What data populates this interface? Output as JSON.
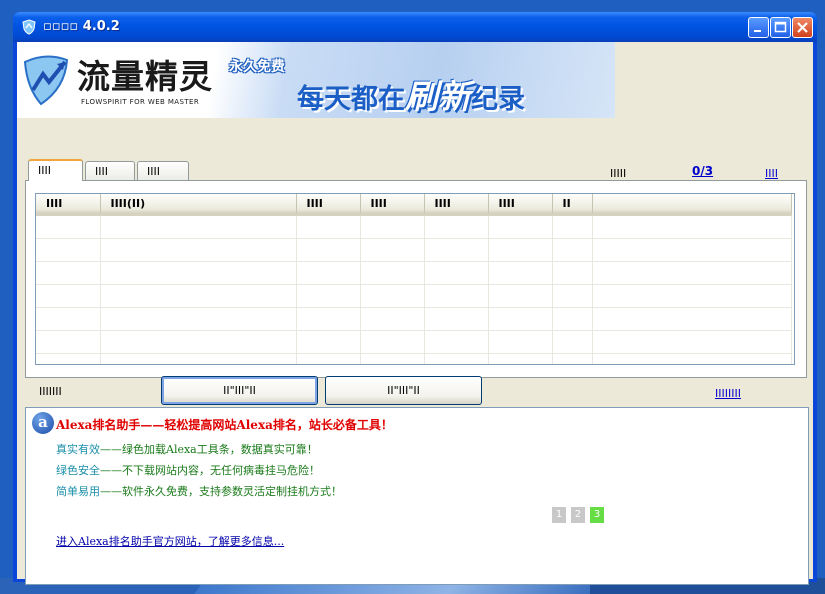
{
  "window": {
    "title": "▫▫▫▫ 4.0.2",
    "minimize": "_",
    "maximize": "□",
    "close": "✕"
  },
  "banner": {
    "logo_title": "流量精灵",
    "logo_subtitle": "FLOWSPIRIT FOR WEB MASTER",
    "free_tag": "永久免费",
    "slogan_a": "每天都在",
    "slogan_b": "刷新",
    "slogan_c": "纪录"
  },
  "tabs": [
    {
      "label": "IIII",
      "active": true
    },
    {
      "label": "IIII",
      "active": false
    },
    {
      "label": "IIII",
      "active": false
    }
  ],
  "counter": {
    "label": "IIIII",
    "value": "0/3"
  },
  "top_link": "IIII",
  "table": {
    "columns": [
      "IIII",
      "IIII(II)",
      "IIII",
      "IIII",
      "IIII",
      "IIII",
      "II",
      ""
    ],
    "rows": 7
  },
  "footer": {
    "left_text": "IIIIIII",
    "button1": "II\"III\"II",
    "button2": "II\"III\"II",
    "right_link": "IIIIIIII"
  },
  "info": {
    "logo_letter": "a",
    "title": "Alexa排名助手——轻松提高网站Alexa排名，站长必备工具！",
    "lines": [
      {
        "key": "真实有效",
        "text": "——绿色加载Alexa工具条，数据真实可靠！"
      },
      {
        "key": "绿色安全",
        "text": "——不下载网站内容，无任何病毒挂马危险！"
      },
      {
        "key": "简单易用",
        "text": "——软件永久免费，支持参数灵活定制挂机方式！"
      }
    ],
    "pager": [
      "1",
      "2",
      "3"
    ],
    "pager_active": "3",
    "link": "进入Alexa排名助手官方网站，了解更多信息..."
  },
  "colors": {
    "titlebar": "#0053e1",
    "client": "#ece9d8",
    "alert_red": "#e00000",
    "link_blue": "#0000cc"
  }
}
